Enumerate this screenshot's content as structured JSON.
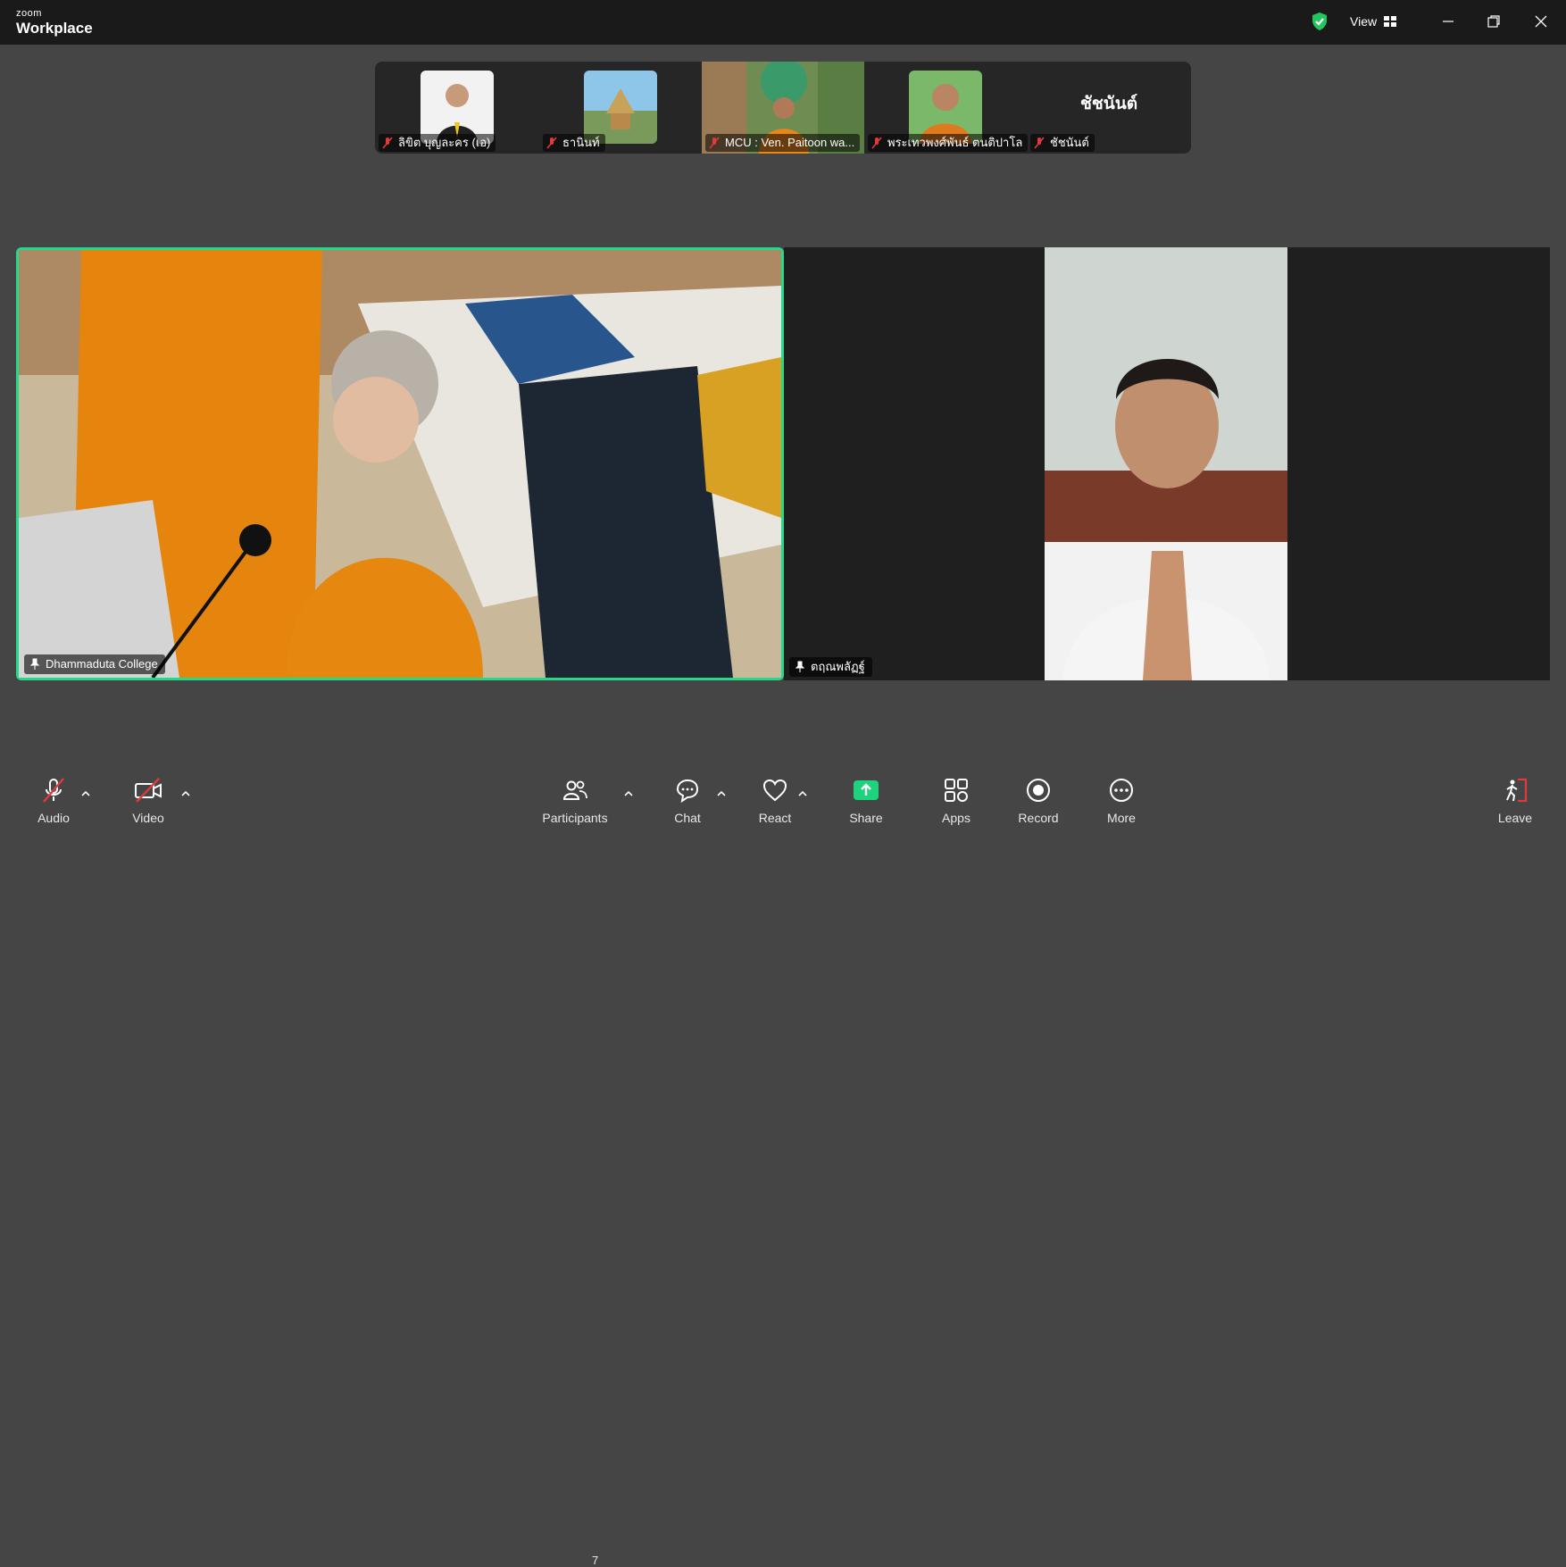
{
  "app": {
    "brand_small": "zoom",
    "brand_name": "Workplace",
    "view_label": "View"
  },
  "thumbnails": [
    {
      "name": "ลิขิต บุญละคร (เอ)",
      "muted": true
    },
    {
      "name": "ธานินท์",
      "muted": true
    },
    {
      "name": "MCU : Ven. Paitoon wa...",
      "muted": true
    },
    {
      "name": "พระเทวพงศ์พันธ์ ตนติปาโล",
      "muted": true
    },
    {
      "name": "ชัชนันต์",
      "muted": true,
      "display": "ชัชนันต์"
    }
  ],
  "main_tiles": [
    {
      "name": "Dhammaduta College",
      "active": true
    },
    {
      "name": "ตฤณพลัฏฐ์",
      "active": false
    }
  ],
  "toolbar": {
    "audio": "Audio",
    "video": "Video",
    "participants": "Participants",
    "participants_count": "7",
    "chat": "Chat",
    "react": "React",
    "share": "Share",
    "apps": "Apps",
    "record": "Record",
    "more": "More",
    "leave": "Leave"
  },
  "colors": {
    "accent_green": "#23d98a",
    "muted_red": "#e0393e",
    "share_green": "#1ed37d"
  }
}
